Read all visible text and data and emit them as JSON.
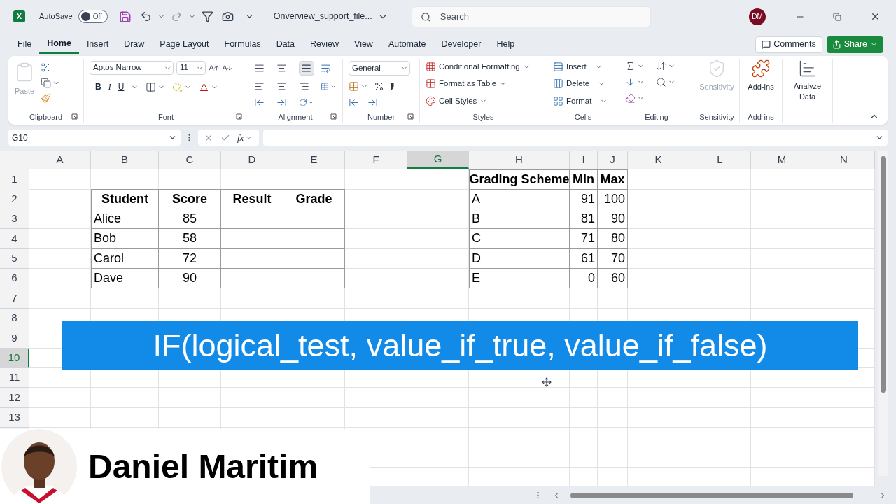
{
  "title_bar": {
    "app_logo": "X",
    "autosave_label": "AutoSave",
    "autosave": {
      "on": false,
      "label": "Off"
    },
    "file_name": "Onverview_support_file...",
    "search_placeholder": "Search",
    "avatar": "DM"
  },
  "menu_tabs": [
    {
      "label": "File",
      "selected": false
    },
    {
      "label": "Home",
      "selected": true
    },
    {
      "label": "Insert",
      "selected": false
    },
    {
      "label": "Draw",
      "selected": false
    },
    {
      "label": "Page Layout",
      "selected": false
    },
    {
      "label": "Formulas",
      "selected": false
    },
    {
      "label": "Data",
      "selected": false
    },
    {
      "label": "Review",
      "selected": false
    },
    {
      "label": "View",
      "selected": false
    },
    {
      "label": "Automate",
      "selected": false
    },
    {
      "label": "Developer",
      "selected": false
    },
    {
      "label": "Help",
      "selected": false
    }
  ],
  "comments_button": "Comments",
  "share_button": "Share",
  "ribbon": {
    "clipboard": {
      "label": "Clipboard",
      "paste": "Paste",
      "disabled": true
    },
    "font": {
      "label": "Font",
      "name": "Aptos Narrow",
      "size": "11",
      "bold": "B",
      "italic": "I",
      "underline": "U"
    },
    "alignment": {
      "label": "Alignment"
    },
    "number": {
      "label": "Number",
      "format": "General"
    },
    "styles": {
      "label": "Styles",
      "items": [
        "Conditional Formatting",
        "Format as Table",
        "Cell Styles"
      ]
    },
    "cells": {
      "label": "Cells",
      "items": [
        "Insert",
        "Delete",
        "Format"
      ]
    },
    "editing": {
      "label": "Editing"
    },
    "sensitivity": {
      "label": "Sensitivity",
      "button": "Sensitivity",
      "disabled": true
    },
    "addins": {
      "label": "Add-ins",
      "button": "Add-ins"
    },
    "analyze": {
      "button": "Analyze Data"
    }
  },
  "formula_bar": {
    "name_box": "G10",
    "function_label": "fx"
  },
  "sheet": {
    "columns": [
      {
        "label": "A",
        "selected": false
      },
      {
        "label": "B",
        "selected": false
      },
      {
        "label": "C",
        "selected": false
      },
      {
        "label": "D",
        "selected": false
      },
      {
        "label": "E",
        "selected": false
      },
      {
        "label": "F",
        "selected": false
      },
      {
        "label": "G",
        "selected": true
      },
      {
        "label": "H",
        "selected": false
      },
      {
        "label": "I",
        "selected": false
      },
      {
        "label": "J",
        "selected": false
      },
      {
        "label": "K",
        "selected": false
      },
      {
        "label": "L",
        "selected": false
      },
      {
        "label": "M",
        "selected": false
      },
      {
        "label": "N",
        "selected": false
      }
    ],
    "rows": [
      {
        "label": "1",
        "selected": false
      },
      {
        "label": "2",
        "selected": false
      },
      {
        "label": "3",
        "selected": false
      },
      {
        "label": "4",
        "selected": false
      },
      {
        "label": "5",
        "selected": false
      },
      {
        "label": "6",
        "selected": false
      },
      {
        "label": "7",
        "selected": false
      },
      {
        "label": "8",
        "selected": false
      },
      {
        "label": "9",
        "selected": false
      },
      {
        "label": "10",
        "selected": true
      },
      {
        "label": "11",
        "selected": false
      },
      {
        "label": "12",
        "selected": false
      },
      {
        "label": "13",
        "selected": false
      }
    ],
    "student_table": {
      "columns": [
        "Student",
        "Score",
        "Result",
        "Grade"
      ],
      "rows": [
        {
          "student": "Alice",
          "score": "85"
        },
        {
          "student": "Bob",
          "score": "58"
        },
        {
          "student": "Carol",
          "score": "72"
        },
        {
          "student": "Dave",
          "score": "90"
        }
      ]
    },
    "grading_table": {
      "columns": [
        "Grading Scheme",
        "Min",
        "Max"
      ],
      "rows": [
        [
          "A",
          "91",
          "100"
        ],
        [
          "B",
          "81",
          "90"
        ],
        [
          "C",
          "71",
          "80"
        ],
        [
          "D",
          "61",
          "70"
        ],
        [
          "E",
          "0",
          "60"
        ]
      ]
    }
  },
  "banner": "IF(logical_test, value_if_true, value_if_false)",
  "presenter": {
    "name": "Daniel Maritim"
  }
}
